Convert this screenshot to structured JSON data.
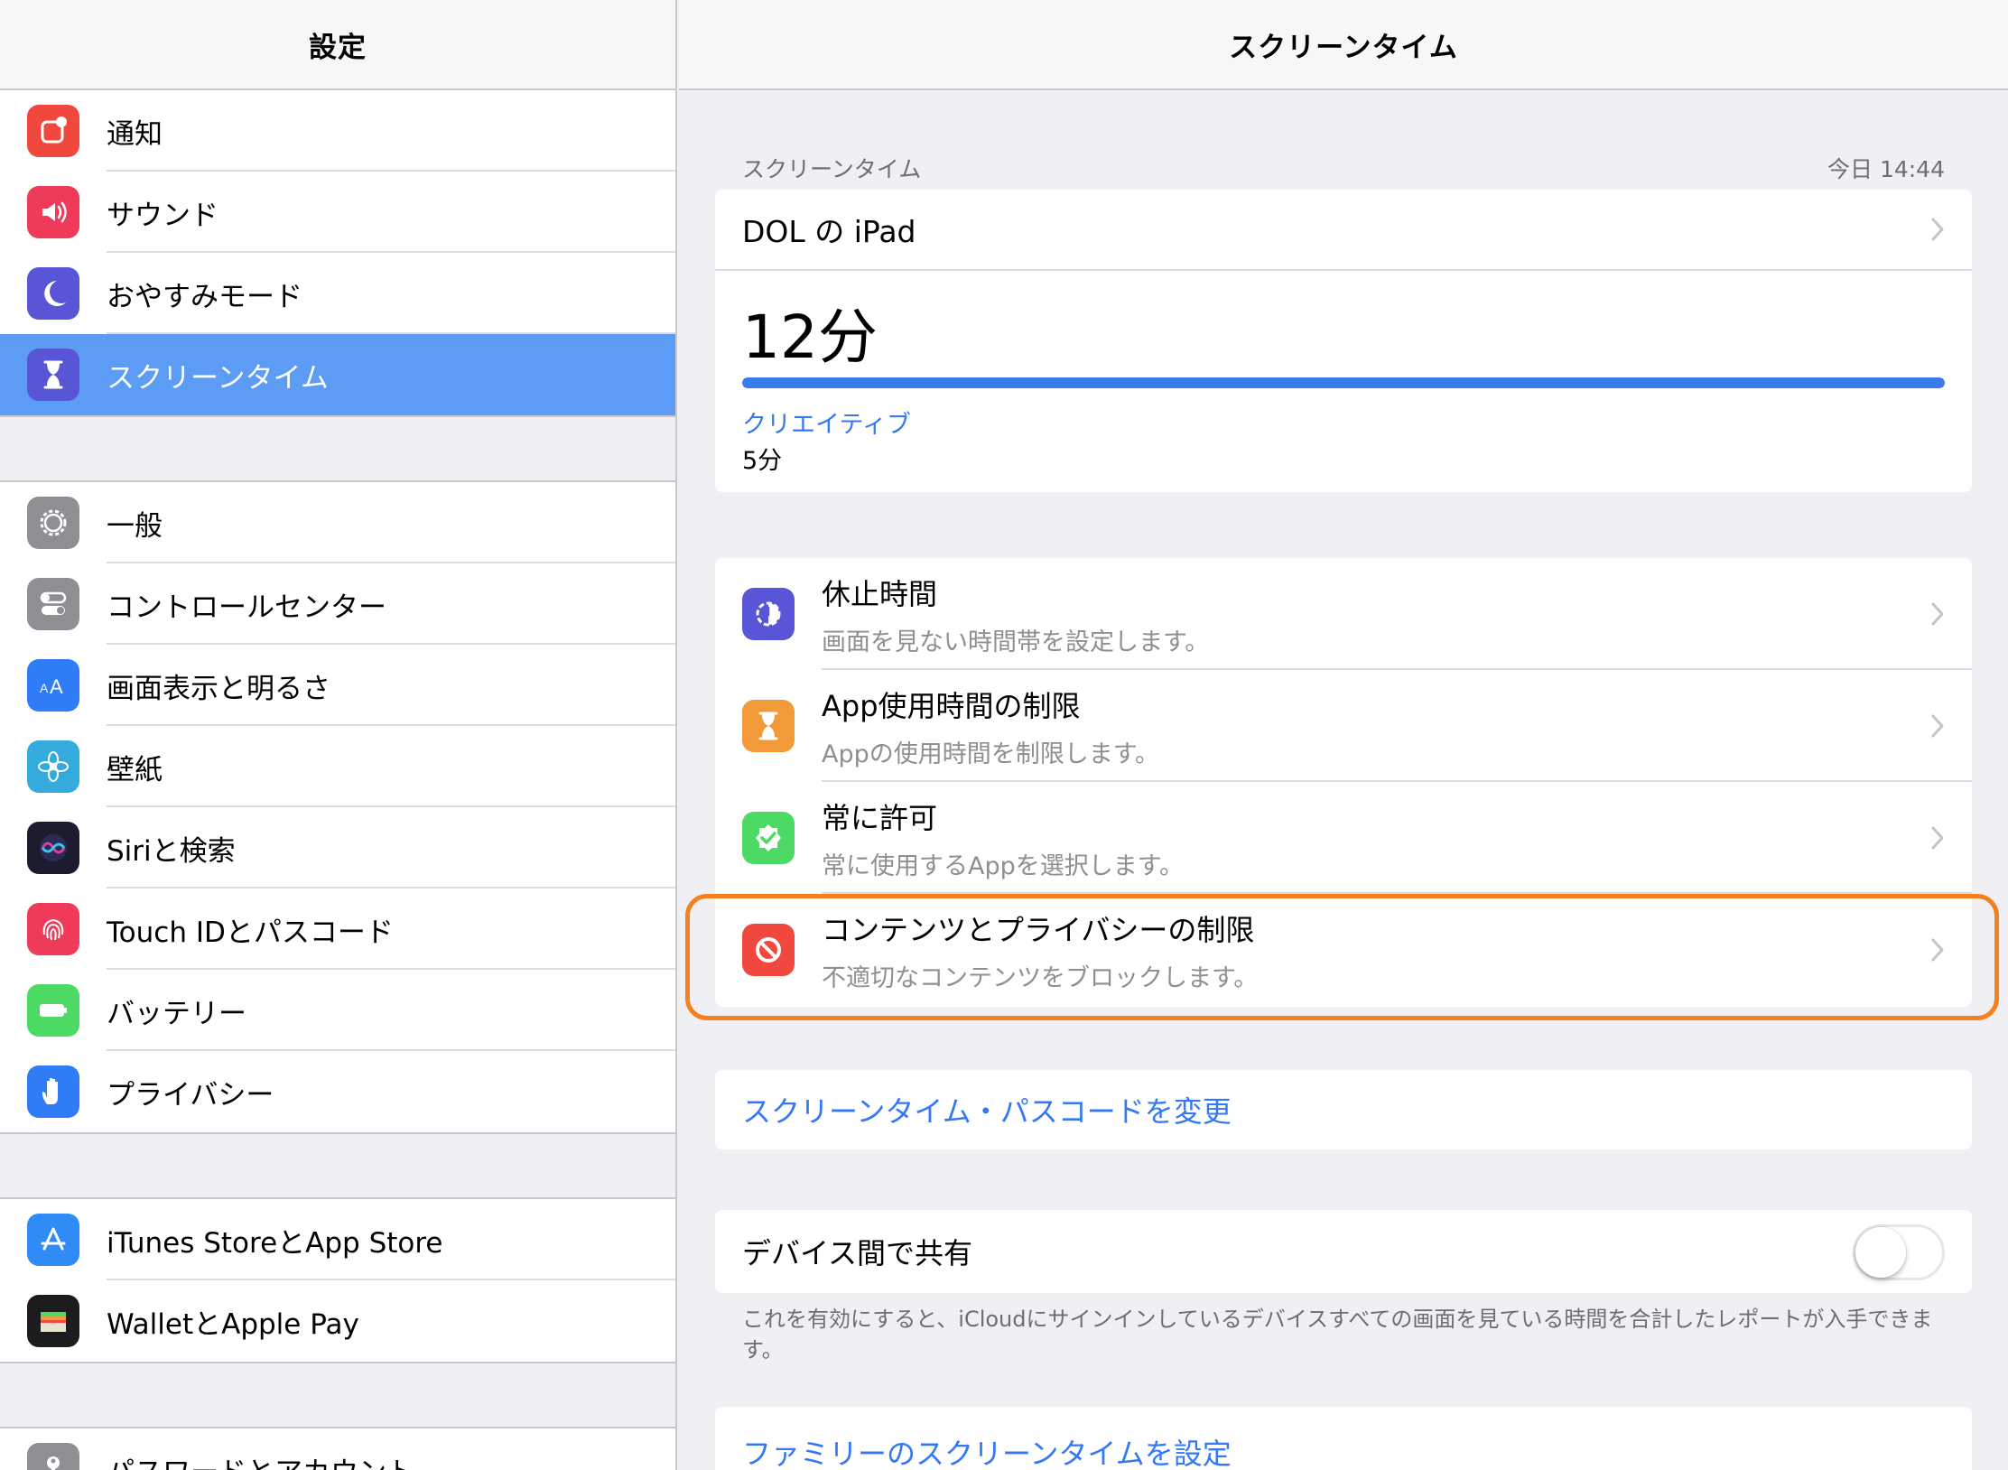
{
  "sidebar": {
    "title": "設定",
    "groups": [
      [
        {
          "label": "通知",
          "icon": "notifications-icon",
          "color": "#f0483e"
        },
        {
          "label": "サウンド",
          "icon": "sound-icon",
          "color": "#f03a5a"
        },
        {
          "label": "おやすみモード",
          "icon": "moon-icon",
          "color": "#5856d6"
        },
        {
          "label": "スクリーンタイム",
          "icon": "hourglass-icon",
          "color": "#5856d6",
          "selected": true
        }
      ],
      [
        {
          "label": "一般",
          "icon": "gear-icon",
          "color": "#8e8e93"
        },
        {
          "label": "コントロールセンター",
          "icon": "toggles-icon",
          "color": "#8e8e93"
        },
        {
          "label": "画面表示と明るさ",
          "icon": "text-size-icon",
          "color": "#2f7cf6"
        },
        {
          "label": "壁紙",
          "icon": "flower-icon",
          "color": "#35aadc"
        },
        {
          "label": "Siriと検索",
          "icon": "siri-icon",
          "color": "#1c1c2e"
        },
        {
          "label": "Touch IDとパスコード",
          "icon": "fingerprint-icon",
          "color": "#f03a5a"
        },
        {
          "label": "バッテリー",
          "icon": "battery-icon",
          "color": "#4cd964"
        },
        {
          "label": "プライバシー",
          "icon": "hand-icon",
          "color": "#2f7cf6"
        }
      ],
      [
        {
          "label": "iTunes StoreとApp Store",
          "icon": "app-store-icon",
          "color": "#2f8cf6"
        },
        {
          "label": "WalletとApple Pay",
          "icon": "wallet-icon",
          "color": "#1c1c1e"
        }
      ],
      [
        {
          "label": "パスワードとアカウント",
          "icon": "key-icon",
          "color": "#8e8e93"
        }
      ]
    ]
  },
  "detail": {
    "title": "スクリーンタイム",
    "section_header": "スクリーンタイム",
    "section_time": "今日 14:44",
    "device_name": "DOL の iPad",
    "total_time": "12分",
    "usage_fraction": 1.0,
    "category_name": "クリエイティブ",
    "category_time": "5分",
    "options": [
      {
        "title": "休止時間",
        "subtitle": "画面を見ない時間帯を設定します。",
        "icon": "downtime-icon",
        "color": "#5856d6"
      },
      {
        "title": "App使用時間の制限",
        "subtitle": "Appの使用時間を制限します。",
        "icon": "hourglass-icon",
        "color": "#f29a38"
      },
      {
        "title": "常に許可",
        "subtitle": "常に使用するAppを選択します。",
        "icon": "checkmark-badge-icon",
        "color": "#4cd964"
      },
      {
        "title": "コンテンツとプライバシーの制限",
        "subtitle": "不適切なコンテンツをブロックします。",
        "icon": "restriction-icon",
        "color": "#f0483e"
      }
    ],
    "passcode_link": "スクリーンタイム・パスコードを変更",
    "share_label": "デバイス間で共有",
    "share_enabled": false,
    "share_footnote": "これを有効にすると、iCloudにサインインしているデバイスすべての画面を見ている時間を合計したレポートが入手できます。",
    "family_link": "ファミリーのスクリーンタイムを設定"
  },
  "colors": {
    "accent": "#3478f6",
    "selection": "#5c9cf5",
    "highlight_outline": "#f5801e"
  }
}
